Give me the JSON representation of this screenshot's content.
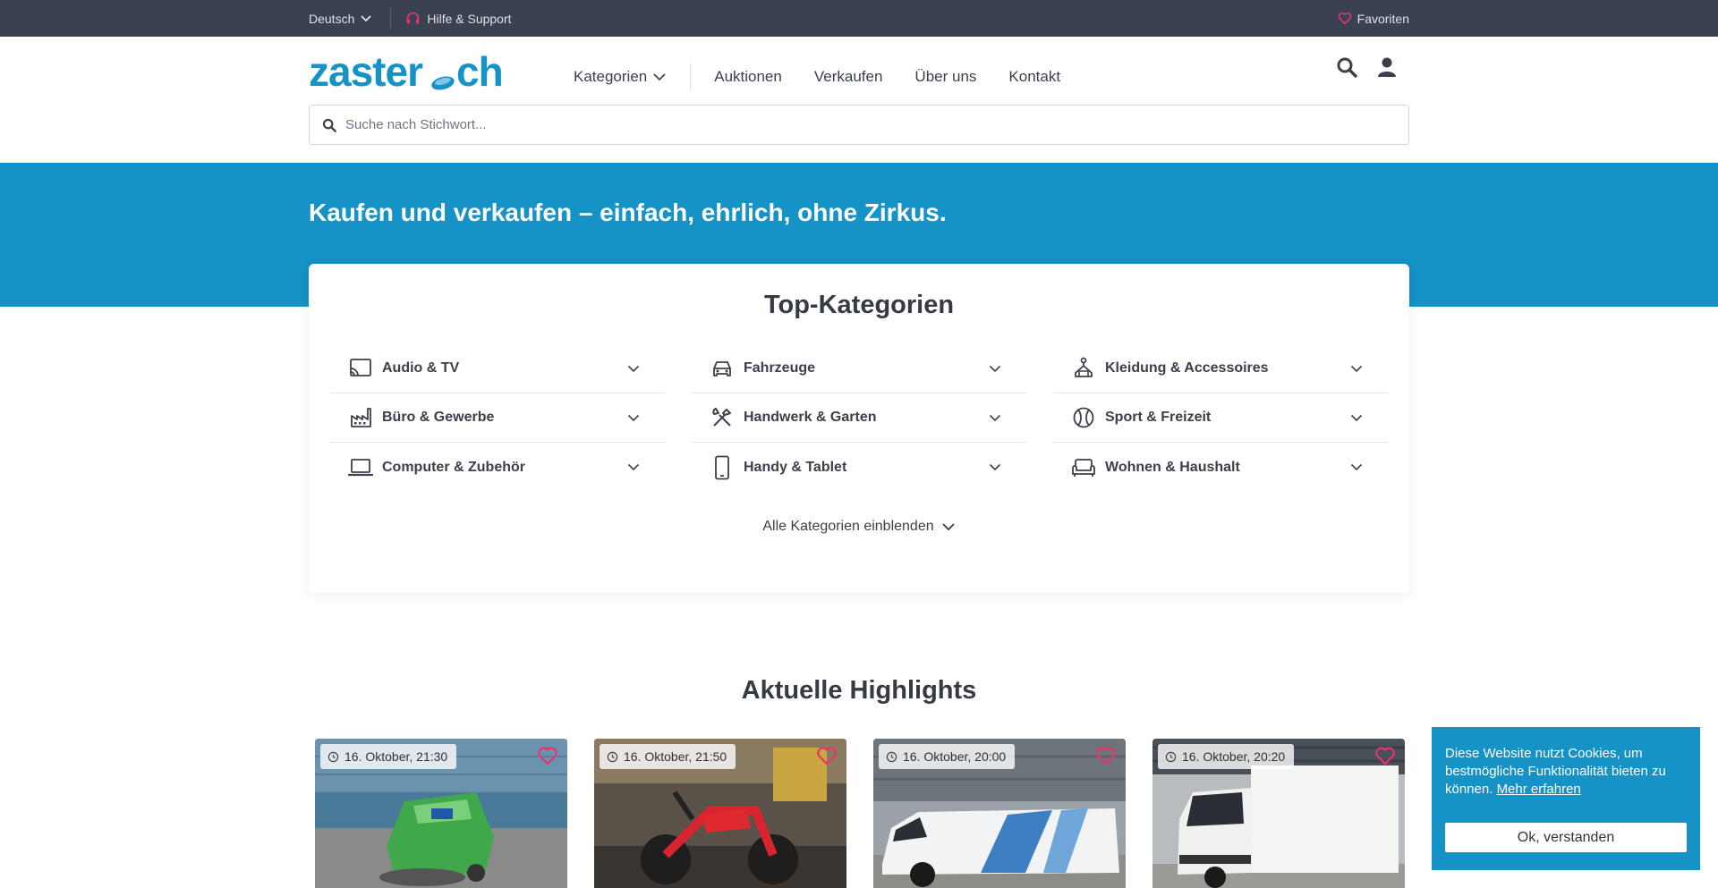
{
  "topbar": {
    "language": "Deutsch",
    "help": "Hilfe & Support",
    "favorites": "Favoriten"
  },
  "header": {
    "logo_text": "zaster.ch",
    "nav": {
      "categories": "Kategorien",
      "auctions": "Auktionen",
      "sell": "Verkaufen",
      "about": "Über uns",
      "contact": "Kontakt"
    },
    "search_placeholder": "Suche nach Stichwort..."
  },
  "hero": {
    "headline": "Kaufen und verkaufen – einfach, ehrlich, ohne Zirkus."
  },
  "categories": {
    "title": "Top-Kategorien",
    "items": [
      {
        "label": "Audio & TV",
        "icon": "cast-tv-icon"
      },
      {
        "label": "Fahrzeuge",
        "icon": "car-icon"
      },
      {
        "label": "Kleidung & Accessoires",
        "icon": "hanger-icon"
      },
      {
        "label": "Büro & Gewerbe",
        "icon": "factory-icon"
      },
      {
        "label": "Handwerk & Garten",
        "icon": "tools-icon"
      },
      {
        "label": "Sport & Freizeit",
        "icon": "ball-icon"
      },
      {
        "label": "Computer & Zubehör",
        "icon": "laptop-icon"
      },
      {
        "label": "Handy & Tablet",
        "icon": "phone-icon"
      },
      {
        "label": "Wohnen & Haushalt",
        "icon": "sofa-icon"
      }
    ],
    "show_all": "Alle Kategorien einblenden"
  },
  "highlights": {
    "title": "Aktuelle Highlights",
    "items": [
      {
        "time": "16. Oktober, 21:30",
        "image": "green-sweeper-machine"
      },
      {
        "time": "16. Oktober, 21:50",
        "image": "red-motorcycle"
      },
      {
        "time": "16. Oktober, 20:00",
        "image": "white-van"
      },
      {
        "time": "16. Oktober, 20:20",
        "image": "white-box-truck"
      }
    ]
  },
  "cookie": {
    "text": "Diese Website nutzt Cookies, um bestmögliche Funktionalität bieten zu können.",
    "link": "Mehr erfahren",
    "button": "Ok, verstanden"
  },
  "colors": {
    "topbar": "#3a4150",
    "primary": "#1592c6",
    "logo": "#1592c6",
    "heart": "#e8336d"
  }
}
